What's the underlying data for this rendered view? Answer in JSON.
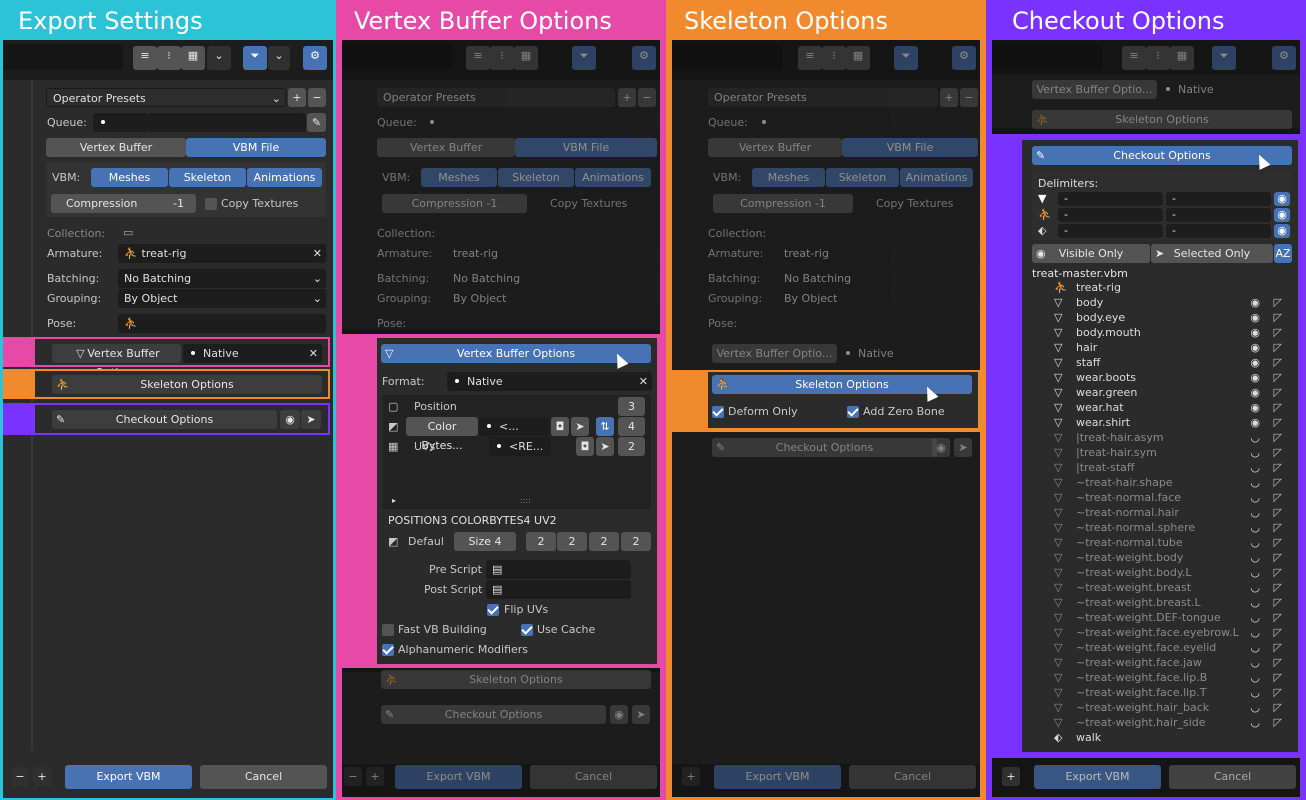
{
  "colors": {
    "cyan": "#2bc3d5",
    "pink": "#e64aa6",
    "orange": "#f08a2c",
    "purple": "#7a32ff",
    "blue": "#4772b3"
  },
  "headers": {
    "export": "Export Settings",
    "vertex": "Vertex Buffer Options",
    "skeleton": "Skeleton Options",
    "checkout": "Checkout Options"
  },
  "common": {
    "operator_presets": "Operator Presets",
    "queue_label": "Queue:",
    "tab_vertex_buffer": "Vertex Buffer",
    "tab_vbm_file": "VBM File",
    "vbm_label": "VBM:",
    "vbm_meshes": "Meshes",
    "vbm_skeleton": "Skeleton",
    "vbm_animations": "Animations",
    "compression_label": "Compression",
    "compression_value": "-1",
    "copy_textures": "Copy Textures",
    "collection_label": "Collection:",
    "armature_label": "Armature:",
    "armature_value": "treat-rig",
    "batching_label": "Batching:",
    "batching_value": "No Batching",
    "grouping_label": "Grouping:",
    "grouping_value": "By Object",
    "pose_label": "Pose:",
    "vb_options": "Vertex Buffer Options",
    "vb_native": "Native",
    "vb_options_trunc": "Vertex Buffer Optio...",
    "skeleton_options": "Skeleton Options",
    "checkout_options": "Checkout Options",
    "export_vbm": "Export VBM",
    "cancel": "Cancel"
  },
  "vertex": {
    "format_label": "Format:",
    "format_value": "Native",
    "attributes": [
      {
        "name": "Position",
        "count": "3"
      },
      {
        "name": "Color Bytes...",
        "value": "<...",
        "count": "4"
      },
      {
        "name": "UVs",
        "value": "<RE...",
        "count": "2"
      }
    ],
    "format_string": "POSITION3 COLORBYTES4 UV2",
    "default_label": "Defaul",
    "size_label": "Size",
    "size_value": "4",
    "size_fields": [
      "2",
      "2",
      "2",
      "2"
    ],
    "pre_script": "Pre Script",
    "post_script": "Post Script",
    "flip_uvs": "Flip UVs",
    "fast_vb": "Fast VB Building",
    "use_cache": "Use Cache",
    "alnum": "Alphanumeric Modifiers"
  },
  "skeleton": {
    "deform_only": "Deform Only",
    "add_zero_bone": "Add Zero Bone"
  },
  "checkout": {
    "delimiters": "Delimiters:",
    "dash": "-",
    "visible_only": "Visible Only",
    "selected_only": "Selected Only",
    "az": "AZ",
    "root": "treat-master.vbm",
    "items": [
      {
        "name": "treat-rig",
        "vis": false,
        "icon": "armature-icon"
      },
      {
        "name": "body",
        "vis": true,
        "icon": "mesh-icon"
      },
      {
        "name": "body.eye",
        "vis": true,
        "icon": "mesh-icon"
      },
      {
        "name": "body.mouth",
        "vis": true,
        "icon": "mesh-icon"
      },
      {
        "name": "hair",
        "vis": true,
        "icon": "mesh-icon"
      },
      {
        "name": "staff",
        "vis": true,
        "icon": "mesh-icon"
      },
      {
        "name": "wear.boots",
        "vis": true,
        "icon": "mesh-icon"
      },
      {
        "name": "wear.green",
        "vis": true,
        "icon": "mesh-icon"
      },
      {
        "name": "wear.hat",
        "vis": true,
        "icon": "mesh-icon"
      },
      {
        "name": "wear.shirt",
        "vis": true,
        "icon": "mesh-icon"
      },
      {
        "name": "|treat-hair.asym",
        "vis": false,
        "icon": "mesh-icon"
      },
      {
        "name": "|treat-hair.sym",
        "vis": false,
        "icon": "mesh-icon"
      },
      {
        "name": "|treat-staff",
        "vis": false,
        "icon": "mesh-icon"
      },
      {
        "name": "~treat-hair.shape",
        "vis": false,
        "icon": "mesh-icon"
      },
      {
        "name": "~treat-normal.face",
        "vis": false,
        "icon": "mesh-icon"
      },
      {
        "name": "~treat-normal.hair",
        "vis": false,
        "icon": "mesh-icon"
      },
      {
        "name": "~treat-normal.sphere",
        "vis": false,
        "icon": "mesh-icon"
      },
      {
        "name": "~treat-normal.tube",
        "vis": false,
        "icon": "mesh-icon"
      },
      {
        "name": "~treat-weight.body",
        "vis": false,
        "icon": "mesh-icon"
      },
      {
        "name": "~treat-weight.body.L",
        "vis": false,
        "icon": "mesh-icon"
      },
      {
        "name": "~treat-weight.breast",
        "vis": false,
        "icon": "mesh-icon"
      },
      {
        "name": "~treat-weight.breast.L",
        "vis": false,
        "icon": "mesh-icon"
      },
      {
        "name": "~treat-weight.DEF-tongue",
        "vis": false,
        "icon": "mesh-icon"
      },
      {
        "name": "~treat-weight.face.eyebrow.L",
        "vis": false,
        "icon": "mesh-icon"
      },
      {
        "name": "~treat-weight.face.eyelid",
        "vis": false,
        "icon": "mesh-icon"
      },
      {
        "name": "~treat-weight.face.jaw",
        "vis": false,
        "icon": "mesh-icon"
      },
      {
        "name": "~treat-weight.face.lip.B",
        "vis": false,
        "icon": "mesh-icon"
      },
      {
        "name": "~treat-weight.face.lip.T",
        "vis": false,
        "icon": "mesh-icon"
      },
      {
        "name": "~treat-weight.hair_back",
        "vis": false,
        "icon": "mesh-icon"
      },
      {
        "name": "~treat-weight.hair_side",
        "vis": false,
        "icon": "mesh-icon"
      },
      {
        "name": "walk",
        "vis": false,
        "icon": "action-icon"
      }
    ]
  }
}
